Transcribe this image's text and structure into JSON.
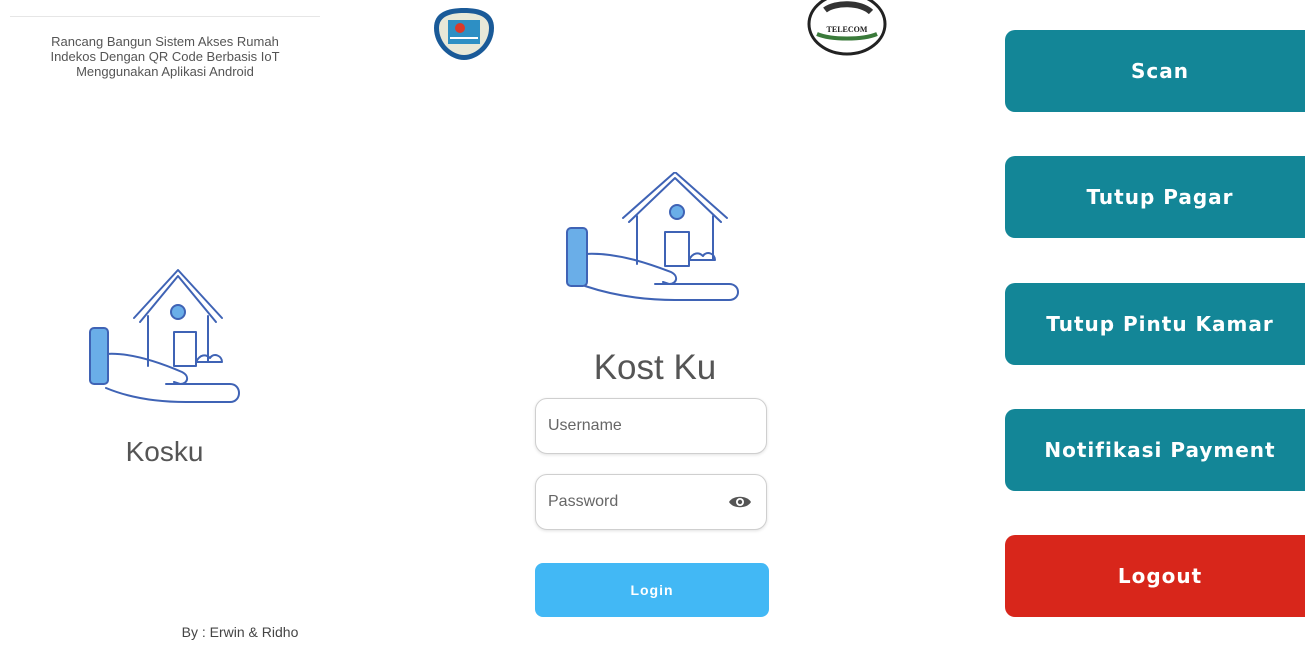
{
  "left": {
    "description": [
      "Rancang Bangun Sistem Akses Rumah",
      "Indekos Dengan QR Code Berbasis IoT",
      "Menggunakan Aplikasi Android"
    ],
    "app_name": "Kosku",
    "credit": "By : Erwin & Ridho",
    "icon": "house-hand-icon"
  },
  "middle": {
    "logo_left": "university-seal-logo",
    "logo_right_text": "TELECOM",
    "icon": "house-hand-icon",
    "title": "Kost Ku",
    "username_placeholder": "Username",
    "password_placeholder": "Password",
    "password_toggle_icon": "eye-icon",
    "login_label": "Login"
  },
  "right": {
    "buttons": [
      {
        "label": "Scan",
        "color": "#138697"
      },
      {
        "label": "Tutup Pagar",
        "color": "#138697"
      },
      {
        "label": "Tutup Pintu Kamar",
        "color": "#138697"
      },
      {
        "label": "Notifikasi Payment",
        "color": "#138697"
      },
      {
        "label": "Logout",
        "color": "#d8261b"
      }
    ]
  },
  "colors": {
    "accent_teal": "#138697",
    "danger_red": "#d8261b",
    "login_blue": "#42b8f5",
    "icon_blue": "#6aaee8",
    "icon_line": "#3f63b5"
  }
}
